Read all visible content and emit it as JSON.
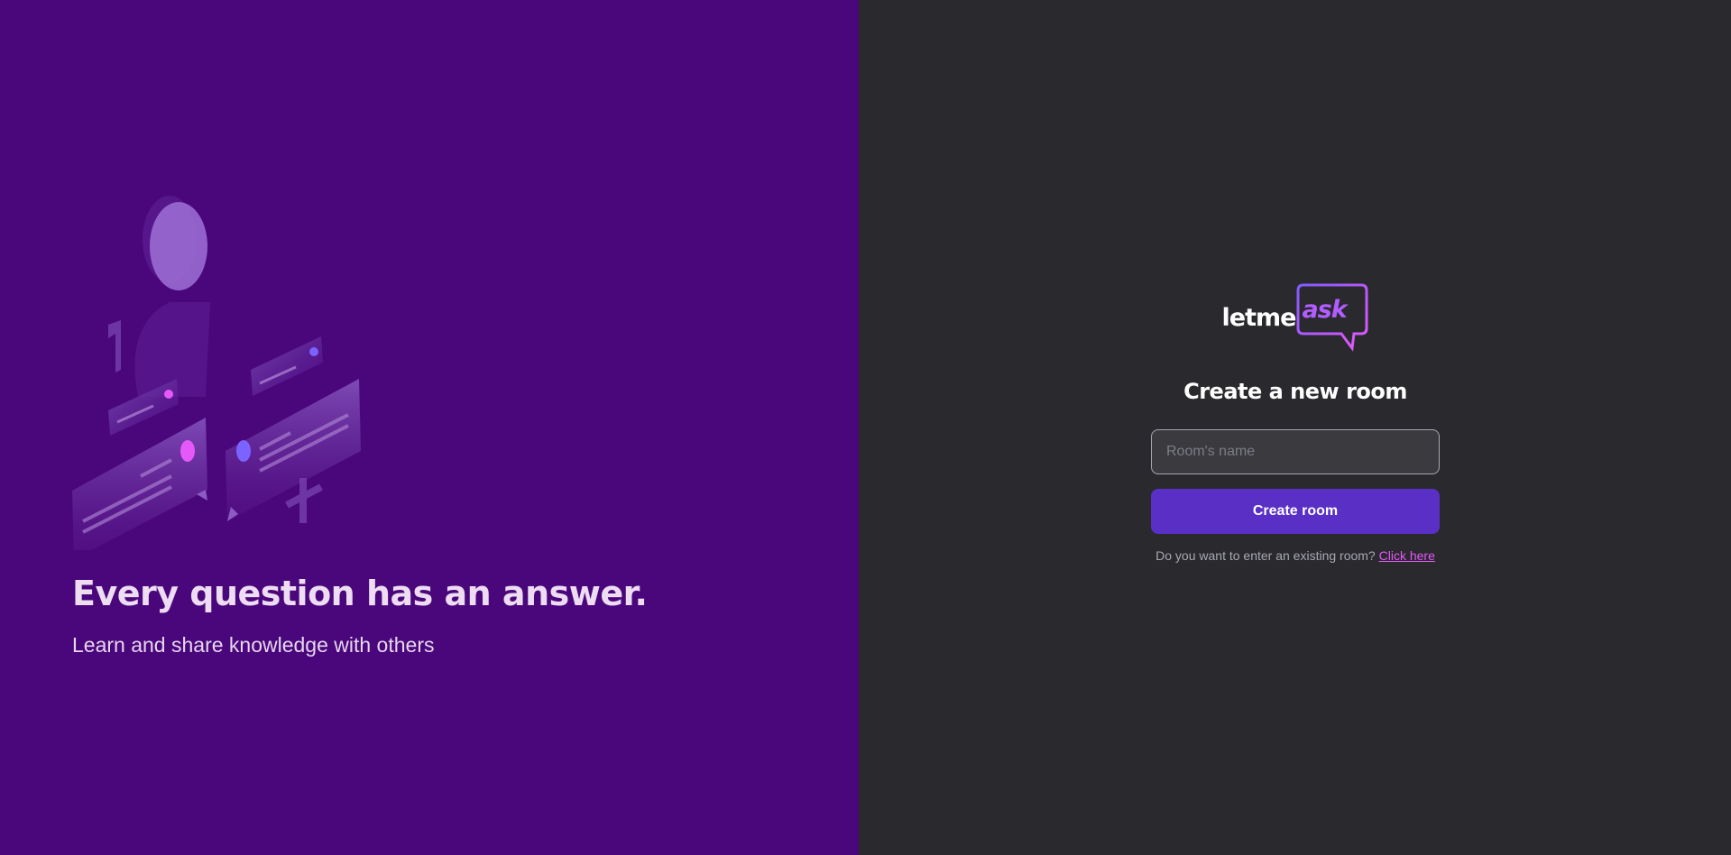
{
  "aside": {
    "title": "Every question has an answer.",
    "subtitle": "Learn and share knowledge with others",
    "background_color": "#4a077c",
    "illustration_icon": "person-chat-illustration"
  },
  "main": {
    "background_color": "#29292e",
    "logo": {
      "word": "letme",
      "accent_word": "ask",
      "icon": "speech-bubble-icon",
      "accent_color": "#b25dff"
    },
    "heading": "Create a new room",
    "room_input": {
      "value": "",
      "placeholder": "Room's name"
    },
    "create_button_label": "Create room",
    "button_color": "#5a2fc6",
    "existing_prompt": "Do you want to enter an existing room?",
    "existing_link_label": "Click here",
    "link_color": "#e559f9"
  }
}
